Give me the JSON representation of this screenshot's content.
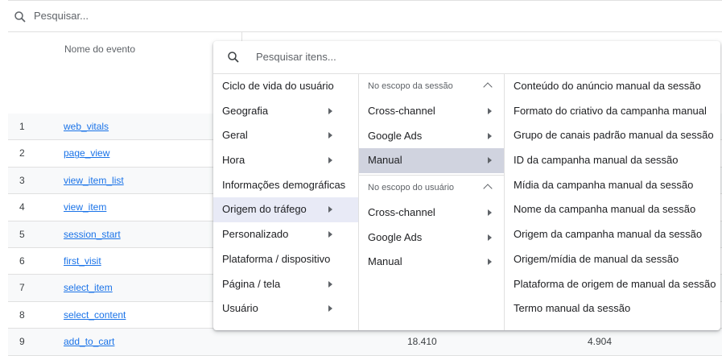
{
  "report": {
    "search_placeholder": "Pesquisar...",
    "column_header": "Nome do evento",
    "rows": [
      {
        "num": "1",
        "name": "web_vitals",
        "v1": "",
        "v2": ""
      },
      {
        "num": "2",
        "name": "page_view",
        "v1": "",
        "v2": ""
      },
      {
        "num": "3",
        "name": "view_item_list",
        "v1": "",
        "v2": ""
      },
      {
        "num": "4",
        "name": "view_item",
        "v1": "",
        "v2": ""
      },
      {
        "num": "5",
        "name": "session_start",
        "v1": "",
        "v2": ""
      },
      {
        "num": "6",
        "name": "first_visit",
        "v1": "",
        "v2": ""
      },
      {
        "num": "7",
        "name": "select_item",
        "v1": "",
        "v2": ""
      },
      {
        "num": "8",
        "name": "select_content",
        "v1": "",
        "v2": ""
      },
      {
        "num": "9",
        "name": "add_to_cart",
        "v1": "18.410",
        "v2": "4.904"
      }
    ]
  },
  "popup": {
    "search_placeholder": "Pesquisar itens...",
    "categories": [
      {
        "label": "Ciclo de vida do usuário",
        "has_submenu": false
      },
      {
        "label": "Geografia",
        "has_submenu": true
      },
      {
        "label": "Geral",
        "has_submenu": true
      },
      {
        "label": "Hora",
        "has_submenu": true
      },
      {
        "label": "Informações demográficas",
        "has_submenu": false
      },
      {
        "label": "Origem do tráfego",
        "has_submenu": true,
        "selected": true
      },
      {
        "label": "Personalizado",
        "has_submenu": true
      },
      {
        "label": "Plataforma / dispositivo",
        "has_submenu": false
      },
      {
        "label": "Página / tela",
        "has_submenu": true
      },
      {
        "label": "Usuário",
        "has_submenu": true
      }
    ],
    "scopes": {
      "session_header": "No escopo da sessão",
      "session_items": [
        "Cross-channel",
        "Google Ads",
        "Manual"
      ],
      "user_header": "No escopo do usuário",
      "user_items": [
        "Cross-channel",
        "Google Ads",
        "Manual"
      ]
    },
    "dimensions": [
      "Conteúdo do anúncio manual da sessão",
      "Formato do criativo da campanha manual",
      "Grupo de canais padrão manual da sessão",
      "ID da campanha manual da sessão",
      "Mídia da campanha manual da sessão",
      "Nome da campanha manual da sessão",
      "Origem da campanha manual da sessão",
      "Origem/mídia de manual da sessão",
      "Plataforma de origem de manual da sessão",
      "Termo manual da sessão"
    ]
  },
  "icons": {
    "search": "search-icon",
    "submenu": "chevron-right-icon",
    "collapse": "chevron-up-icon"
  },
  "colors": {
    "link": "#1a73e8",
    "selected_bg": "#e8eaf6",
    "selected_scope_bg": "#d0d3df"
  }
}
